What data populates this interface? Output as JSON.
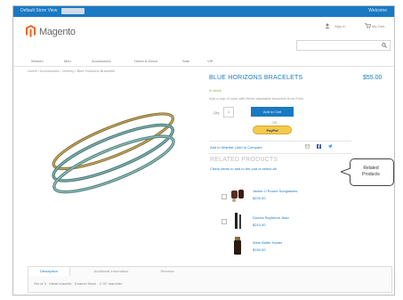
{
  "header": {
    "store_label": "Default Store View",
    "welcome": "Welcome",
    "logo_text": "Magento",
    "account_link": "Sign In",
    "cart_label": "My Cart"
  },
  "nav": {
    "items": [
      "Women",
      "Men",
      "Accessories",
      "Home & Decor",
      "Sale",
      "VIP"
    ]
  },
  "breadcrumbs": "Home / Accessories / Jewelry / Blue Horizons Bracelets",
  "product": {
    "title": "BLUE HORIZONS BRACELETS",
    "price": "$55.00",
    "stock": "In stock",
    "description": "Add a pop of color with these stackable bracelets from Erda.",
    "qty_label": "Qty:",
    "qty_value": "1",
    "add_to_cart": "Add to Cart",
    "or_label": "- OR -",
    "paypal_label": "PayPal",
    "links": "Add to Wishlist  |  Add to Compare"
  },
  "related": {
    "heading": "RELATED PRODUCTS",
    "subtitle": "Check items to add to the cart or select all",
    "items": [
      {
        "name": "Jackie O Round Sunglasses",
        "price": "$225.00"
      },
      {
        "name": "Dumbo Boyfriend Jean",
        "price": "$210.00"
      },
      {
        "name": "Wine Bottle Holder",
        "price": "$150.00"
      }
    ]
  },
  "callout": {
    "line1": "Related",
    "line2": "Products"
  },
  "tabs": {
    "items": [
      "Description",
      "Additional Information",
      "Reviews"
    ],
    "body": "Set of 3 · Metal bracelet · Enamel finish · 2.75\" diameter"
  },
  "colors": {
    "accent": "#1979c3",
    "logo": "#f26322",
    "stock": "#7bbb3c"
  }
}
